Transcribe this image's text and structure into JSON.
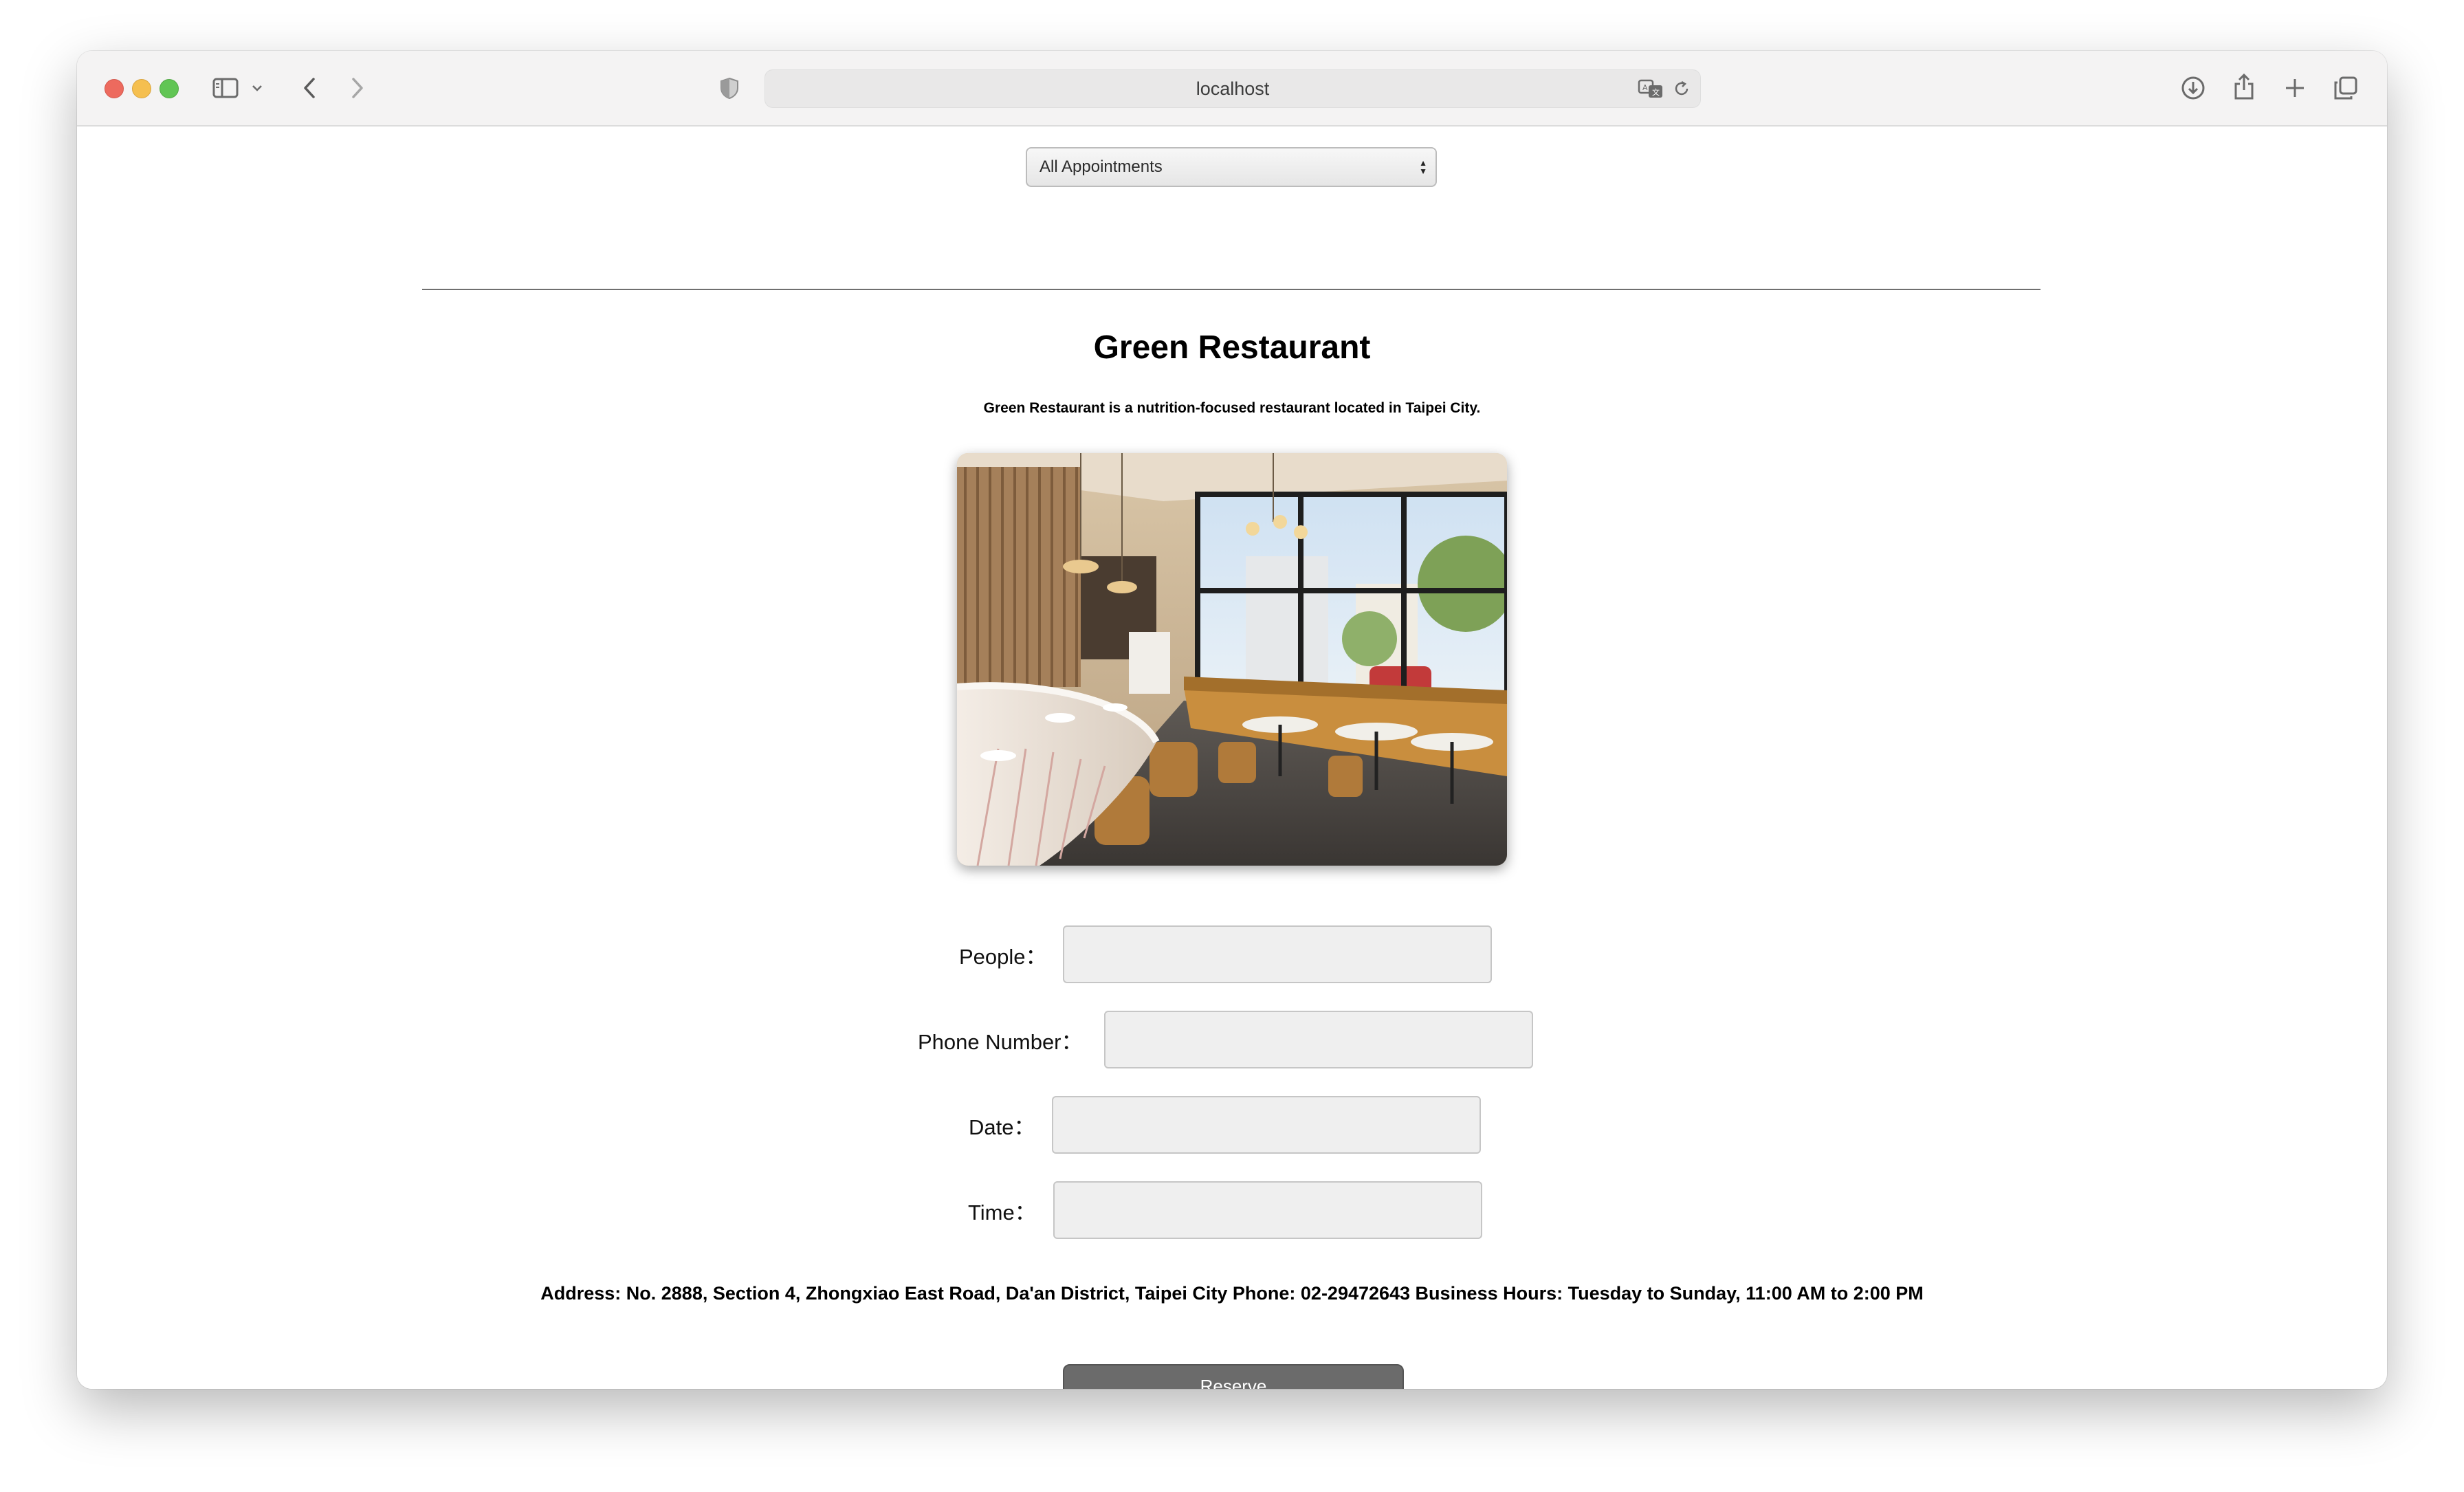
{
  "browser": {
    "url": "localhost",
    "icons": [
      "sidebar-icon",
      "chevron-down-icon",
      "back-icon",
      "forward-icon",
      "privacy-shield-icon",
      "translate-icon",
      "reload-icon",
      "download-icon",
      "share-icon",
      "new-tab-icon",
      "tab-overview-icon"
    ]
  },
  "filter": {
    "selected": "All Appointments"
  },
  "restaurant": {
    "name": "Green Restaurant",
    "description": "Green Restaurant is a nutrition-focused restaurant located in Taipei City.",
    "address_line": "Address: No. 2888, Section 4, Zhongxiao East Road, Da'an District, Taipei City Phone: 02-29472643 Business Hours: Tuesday to Sunday, 11:00 AM to 2:00 PM"
  },
  "form": {
    "people_label": "People：",
    "phone_label": "Phone Number：",
    "date_label": "Date：",
    "time_label": "Time：",
    "people_value": "",
    "phone_value": "",
    "date_value": "",
    "time_value": ""
  },
  "actions": {
    "reserve_label": "Reserve"
  },
  "colors": {
    "button_bg": "#6b6b6b",
    "input_bg": "#efefef",
    "toolbar_bg": "#f4f3f3"
  }
}
